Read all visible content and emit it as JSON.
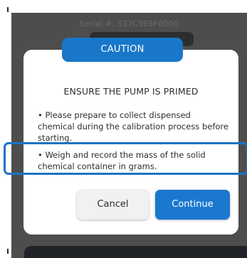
{
  "background": {
    "serial_text": "Serial #: S37C9E6F0000"
  },
  "dialog": {
    "header": "CAUTION",
    "title": "ENSURE THE PUMP IS PRIMED",
    "bullets": [
      "• Please prepare to collect dispensed chemical during the calibration process before starting.",
      "• Weigh and record the mass of the solid chemical container in grams."
    ],
    "buttons": {
      "cancel_label": "Cancel",
      "continue_label": "Continue"
    }
  },
  "colors": {
    "accent": "#1877c9",
    "overlay": "#4d4d4d",
    "highlight_border": "#1b73c6"
  }
}
